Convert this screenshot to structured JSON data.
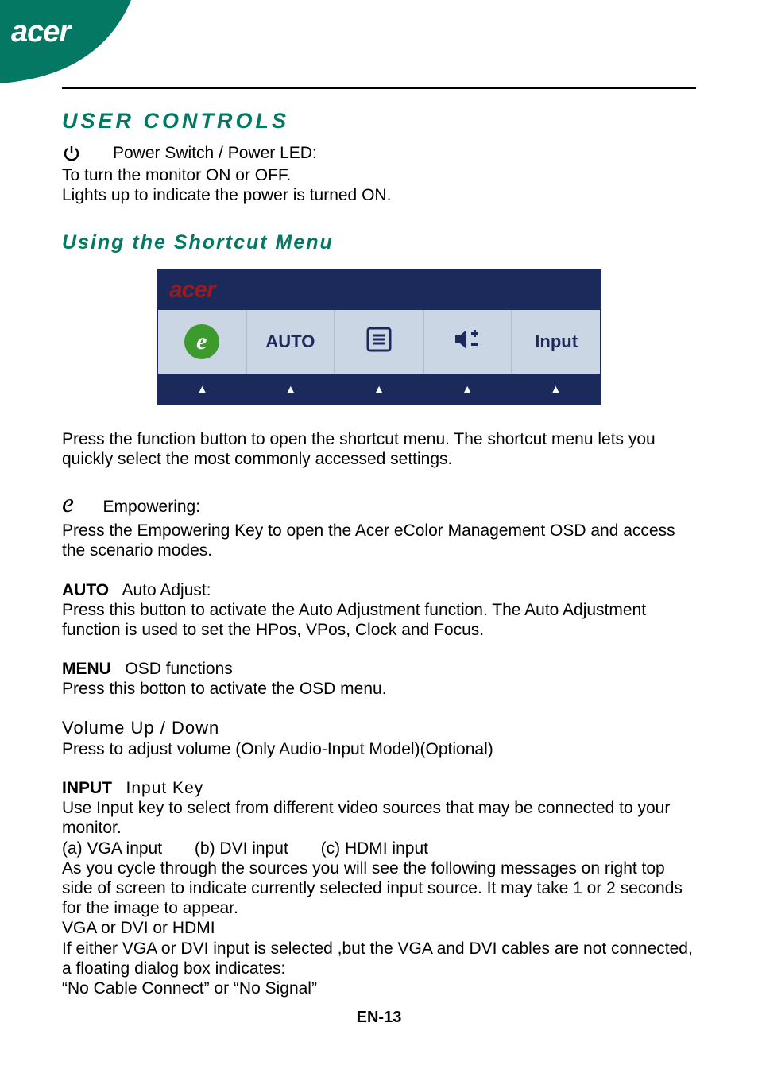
{
  "brand": "acer",
  "sections": {
    "user_controls_heading": "USER CONTROLS",
    "power": {
      "label": "Power Switch / Power LED:",
      "line1": "To turn the monitor ON or OFF.",
      "line2": "Lights up to indicate the power is turned ON."
    },
    "shortcut_heading": "Using   the  Shortcut  Menu",
    "osd": {
      "brand": "acer",
      "buttons": {
        "auto": "AUTO",
        "input": "Input"
      }
    },
    "shortcut_para": "Press the function button to open the shortcut menu. The shortcut menu lets you quickly select the most commonly accessed settings.",
    "empowering": {
      "label": "Empowering:",
      "body": "Press the Empowering Key to open the Acer eColor Management OSD and access the scenario modes."
    },
    "auto": {
      "tag": "AUTO",
      "label": "Auto Adjust:",
      "body": "Press this button to activate the Auto Adjustment function. The Auto Adjustment function is used to set the HPos, VPos, Clock and Focus."
    },
    "menu": {
      "tag": "MENU",
      "label": "OSD functions",
      "body": "Press this botton to activate the OSD menu."
    },
    "volume": {
      "heading": "Volume  Up  /  Down",
      "body": " Press to adjust volume (Only Audio-Input Model)(Optional)"
    },
    "input": {
      "tag": "INPUT",
      "label": "Input Key",
      "l1": "Use Input key to select from different video sources that may be connected to your monitor.",
      "l2": "(a) VGA input       (b) DVI input       (c) HDMI input",
      "l3": "As you cycle through the sources you will see the following messages on right top side of screen to indicate currently selected input source. It may take 1 or 2 seconds for the image to appear.",
      "l4": "VGA   or   DVI   or   HDMI",
      "l5": "If either VGA or DVI input is selected ,but the VGA and DVI cables are not connected, a floating dialog box indicates:",
      "l6": "“No Cable Connect” or “No Signal”"
    }
  },
  "page_number": "EN-13"
}
